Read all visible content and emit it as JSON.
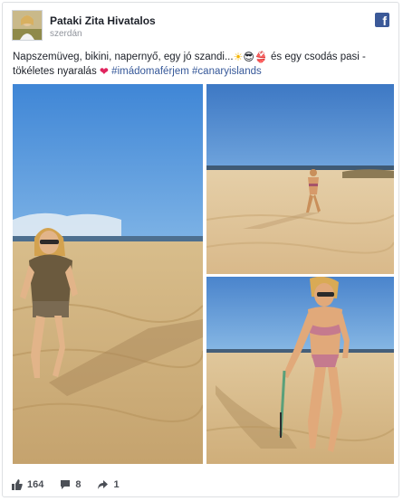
{
  "post": {
    "page_name": "Pataki Zita Hivatalos",
    "timestamp": "szerdán",
    "text_line1": "Napszemüveg, bikini, napernyő, egy jó szandi...",
    "text_line1_tail": " és egy csodás pasi -",
    "text_line2": "tökéletes nyaralás",
    "hashtags": [
      "#imádomaférjem",
      "#canaryislands"
    ],
    "emojis": {
      "sun": "☀",
      "sunglasses": "😎",
      "bikini": "👙",
      "heart": "❤"
    }
  },
  "footer": {
    "likes": "164",
    "comments": "8",
    "shares": "1"
  },
  "colors": {
    "facebook_blue": "#3b5998",
    "hashtag": "#365899",
    "heart": "#e0245e"
  },
  "icons": [
    "facebook-logo-icon",
    "like-thumb-icon",
    "comment-bubble-icon",
    "share-arrow-icon"
  ]
}
